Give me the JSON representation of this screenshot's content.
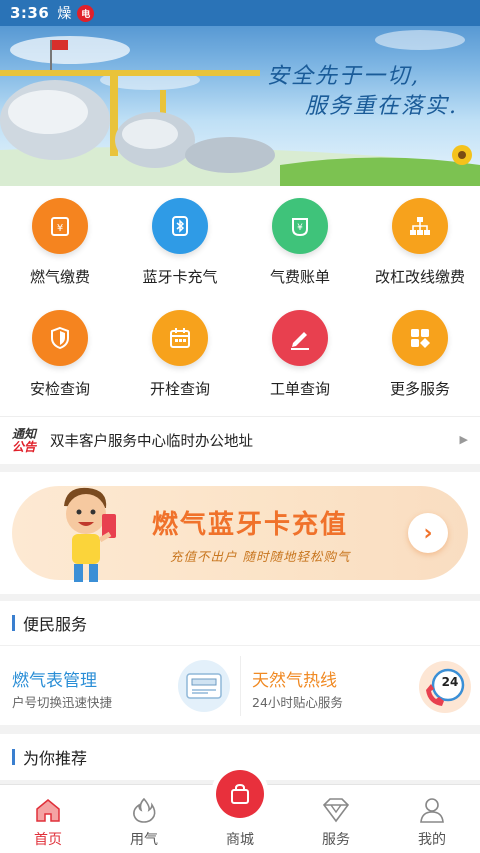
{
  "status_bar": {
    "time": "3:36",
    "notification_badge": "电"
  },
  "banner": {
    "slogan_line1": "安全先于一切,",
    "slogan_line2": "服务重在落实."
  },
  "grid": [
    {
      "label": "燃气缴费",
      "icon": "yen-card-icon",
      "color": "#f5841f"
    },
    {
      "label": "蓝牙卡充气",
      "icon": "bluetooth-icon",
      "color": "#2f9be6"
    },
    {
      "label": "气费账单",
      "icon": "yen-bill-icon",
      "color": "#3fc37a"
    },
    {
      "label": "改杠改线缴费",
      "icon": "network-icon",
      "color": "#f7a21c"
    },
    {
      "label": "安检查询",
      "icon": "shield-icon",
      "color": "#f5841f"
    },
    {
      "label": "开栓查询",
      "icon": "calendar-icon",
      "color": "#f7a21c"
    },
    {
      "label": "工单查询",
      "icon": "edit-icon",
      "color": "#e8404f"
    },
    {
      "label": "更多服务",
      "icon": "grid-more-icon",
      "color": "#f7a21c"
    }
  ],
  "notice": {
    "badge_top": "通知",
    "badge_bottom": "公告",
    "text": "双丰客户服务中心临时办公地址"
  },
  "promo": {
    "title": "燃气蓝牙卡充值",
    "subtitle": "充值不出户  随时随地轻松购气"
  },
  "section_services": {
    "title": "便民服务"
  },
  "services": [
    {
      "title": "燃气表管理",
      "subtitle": "户号切换迅速快捷",
      "title_color": "#2a8ed6"
    },
    {
      "title": "天然气热线",
      "subtitle": "24小时贴心服务",
      "title_color": "#f08a24",
      "badge": "24"
    }
  ],
  "section_recommend": {
    "title": "为你推荐"
  },
  "tabbar": [
    {
      "label": "首页",
      "icon": "home-icon",
      "active": true
    },
    {
      "label": "用气",
      "icon": "flame-icon",
      "active": false
    },
    {
      "label": "商城",
      "icon": "shopping-bag-icon",
      "active": false
    },
    {
      "label": "服务",
      "icon": "diamond-icon",
      "active": false
    },
    {
      "label": "我的",
      "icon": "user-icon",
      "active": false
    }
  ]
}
